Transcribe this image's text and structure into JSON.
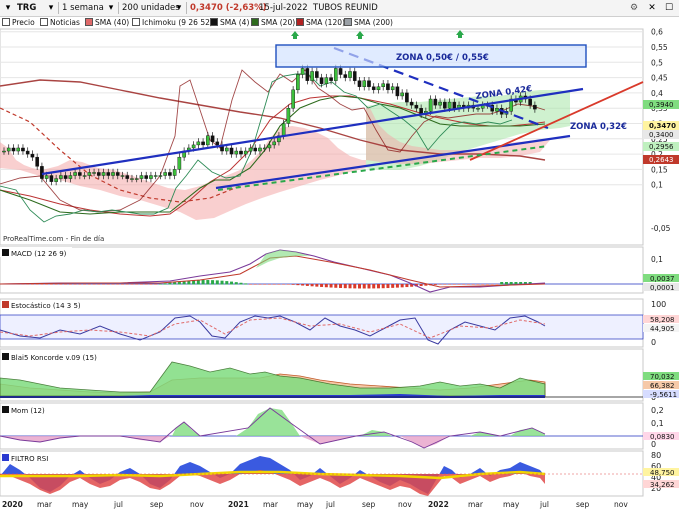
{
  "toolbar": {
    "symbol": "TRG",
    "period": "1 semana",
    "units": "200 unidades",
    "price_change": "0,3470 (-2,63%)",
    "date": "15-jul-2022",
    "name": "TUBOS REUNID"
  },
  "legend": [
    {
      "label": "Precio",
      "color": "#ffffff"
    },
    {
      "label": "Noticias",
      "color": "#ffffff"
    },
    {
      "label": "SMA (40)",
      "color": "#e06a6a"
    },
    {
      "label": "Ichimoku (9 26 52)",
      "color": "#ffffff"
    },
    {
      "label": "SMA (4)",
      "color": "#111111"
    },
    {
      "label": "SMA (20)",
      "color": "#2e6b1e"
    },
    {
      "label": "SMA (120)",
      "color": "#b22222"
    },
    {
      "label": "SMA (200)",
      "color": "#9aa0a6"
    }
  ],
  "attribution": "ProRealTime.com - Fin de día",
  "annotations": {
    "zone_box": "ZONA 0,50€ / 0,55€",
    "zone_042": "ZONA 0,42€",
    "zone_032": "ZONA 0,32€"
  },
  "price_axis": {
    "ticks": [
      "0,6",
      "0,55",
      "0,5",
      "0,45",
      "0,4",
      "0,35",
      "0,3",
      "0,25",
      "0,2",
      "0,15",
      "0,1",
      "-0,05"
    ],
    "price_tags": [
      {
        "text": "0,3940",
        "color": "#7fdc7f"
      },
      {
        "text": "0,3470",
        "color": "#fff4a0"
      },
      {
        "text": "0,3400",
        "color": "#e8e8e8"
      },
      {
        "text": "0,2956",
        "color": "#bff0bf"
      },
      {
        "text": "0,2643",
        "color": "#c0392b"
      }
    ]
  },
  "panels": {
    "macd": {
      "label": "MACD (12 26 9)",
      "ticks": [
        "0,1"
      ],
      "values": [
        "0,0037",
        "0,0001"
      ]
    },
    "stoch": {
      "label": "Estocástico (14 3 5)",
      "ticks": [
        "100",
        "0"
      ],
      "values": [
        "58,208",
        "44,905"
      ]
    },
    "koncorde": {
      "label": "Blai5 Koncorde v.09 (15)",
      "ticks": [
        "0"
      ],
      "values": [
        "70,032",
        "66,382",
        "-9,5611"
      ]
    },
    "mom": {
      "label": "Mom (12)",
      "ticks": [
        "0,2",
        "0,1",
        "0"
      ],
      "values": [
        "0,0830"
      ]
    },
    "rsi": {
      "label": "FILTRO RSI",
      "ticks": [
        "80",
        "60",
        "40",
        "20"
      ],
      "values": [
        "48,750",
        "34,262"
      ]
    }
  },
  "x_axis": [
    "2020",
    "mar",
    "may",
    "jul",
    "sep",
    "nov",
    "2021",
    "mar",
    "may",
    "jul",
    "sep",
    "nov",
    "2022",
    "mar",
    "may",
    "jul",
    "sep",
    "nov"
  ],
  "chart_data": {
    "type": "candlestick",
    "title": "TRG - TUBOS REUNID - 1 semana",
    "ylabel": "",
    "ylim": [
      0.05,
      0.6
    ],
    "x_start": "2020-01-03",
    "weekly_close": [
      0.21,
      0.22,
      0.21,
      0.22,
      0.21,
      0.2,
      0.19,
      0.16,
      0.12,
      0.13,
      0.11,
      0.12,
      0.13,
      0.12,
      0.13,
      0.14,
      0.13,
      0.13,
      0.14,
      0.14,
      0.13,
      0.14,
      0.13,
      0.14,
      0.13,
      0.13,
      0.12,
      0.12,
      0.12,
      0.13,
      0.12,
      0.13,
      0.13,
      0.13,
      0.14,
      0.13,
      0.15,
      0.19,
      0.21,
      0.22,
      0.23,
      0.24,
      0.23,
      0.26,
      0.24,
      0.23,
      0.21,
      0.22,
      0.2,
      0.21,
      0.2,
      0.21,
      0.22,
      0.21,
      0.22,
      0.22,
      0.23,
      0.24,
      0.26,
      0.3,
      0.35,
      0.41,
      0.46,
      0.48,
      0.44,
      0.47,
      0.45,
      0.43,
      0.45,
      0.44,
      0.48,
      0.46,
      0.45,
      0.47,
      0.44,
      0.42,
      0.44,
      0.42,
      0.41,
      0.42,
      0.43,
      0.41,
      0.42,
      0.39,
      0.4,
      0.37,
      0.36,
      0.35,
      0.33,
      0.34,
      0.38,
      0.36,
      0.37,
      0.35,
      0.37,
      0.35,
      0.36,
      0.35,
      0.36,
      0.35,
      0.35,
      0.36,
      0.36,
      0.34,
      0.35,
      0.33,
      0.34,
      0.38,
      0.37,
      0.39,
      0.38,
      0.36,
      0.347
    ],
    "series": [
      {
        "name": "SMA (40)",
        "color": "#b22222"
      },
      {
        "name": "SMA (4)",
        "color": "#111111"
      },
      {
        "name": "SMA (20)",
        "color": "#2e6b1e"
      },
      {
        "name": "SMA (120)",
        "color": "#b22222"
      },
      {
        "name": "SMA (200)",
        "color": "#9aa0a6"
      }
    ],
    "last_price": 0.347,
    "last_change": "-2,63%"
  }
}
